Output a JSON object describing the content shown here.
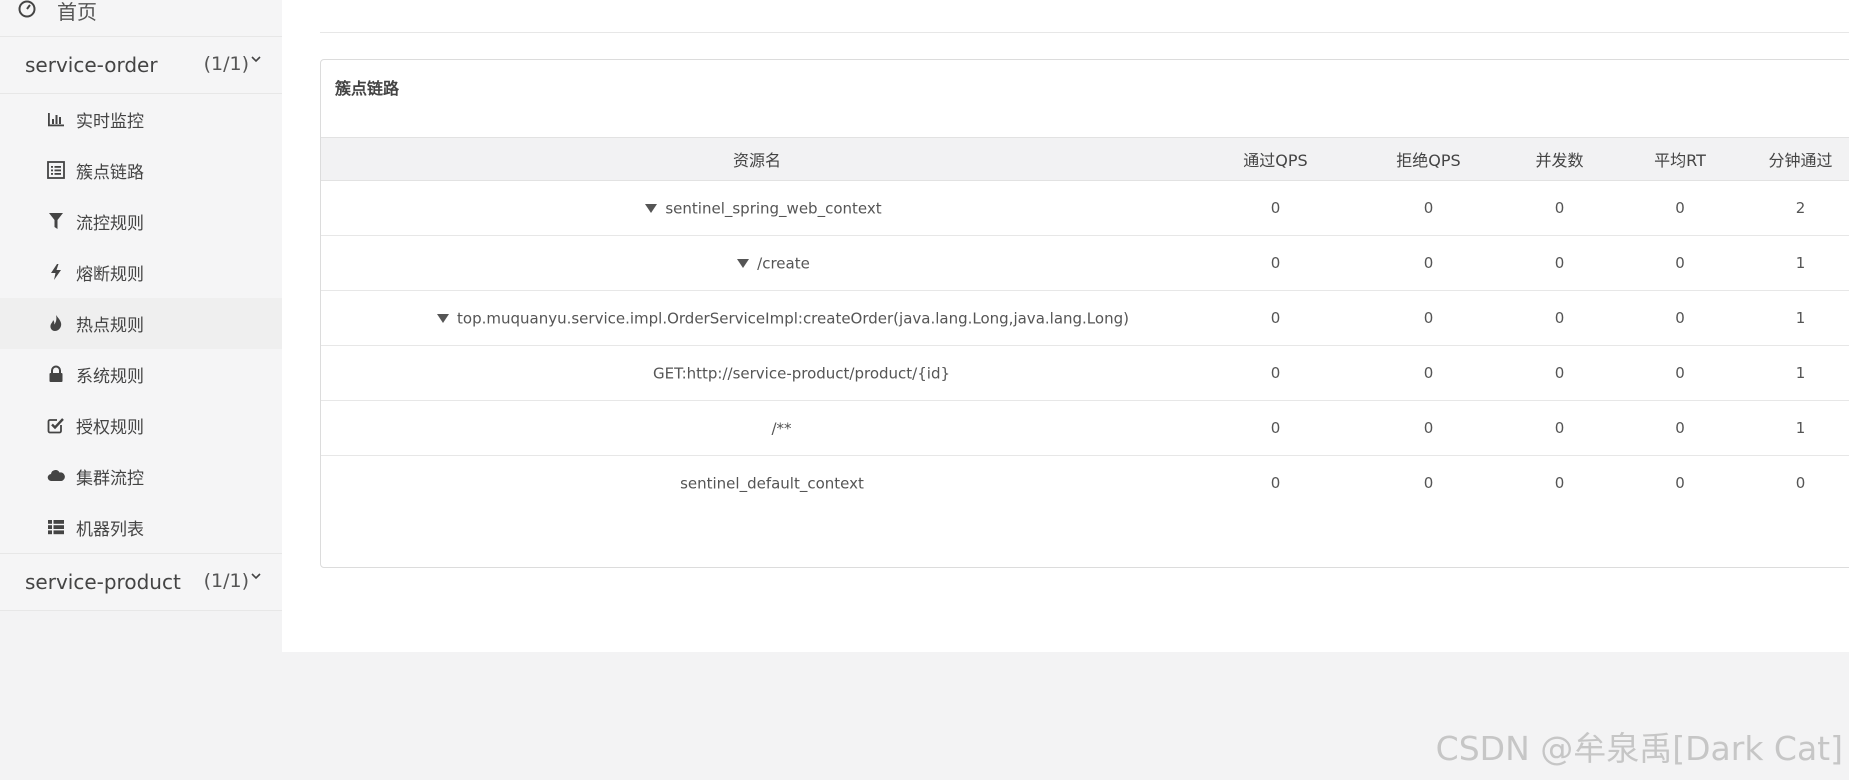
{
  "sidebar": {
    "home": {
      "label": "首页",
      "icon": "dashboard-icon"
    },
    "apps": [
      {
        "name": "service-order",
        "count": "(1/1)",
        "expanded": true,
        "items": [
          {
            "label": "实时监控",
            "icon": "bar-chart-icon"
          },
          {
            "label": "簇点链路",
            "icon": "list-alt-icon"
          },
          {
            "label": "流控规则",
            "icon": "filter-icon"
          },
          {
            "label": "熔断规则",
            "icon": "flash-icon"
          },
          {
            "label": "热点规则",
            "icon": "fire-icon"
          },
          {
            "label": "系统规则",
            "icon": "lock-icon"
          },
          {
            "label": "授权规则",
            "icon": "check-icon"
          },
          {
            "label": "集群流控",
            "icon": "cloud-icon"
          },
          {
            "label": "机器列表",
            "icon": "th-list-icon"
          }
        ]
      },
      {
        "name": "service-product",
        "count": "(1/1)",
        "expanded": false
      }
    ]
  },
  "panel": {
    "title": "簇点链路",
    "columns": [
      "资源名",
      "通过QPS",
      "拒绝QPS",
      "并发数",
      "平均RT",
      "分钟通过"
    ],
    "rows": [
      {
        "resource": "sentinel_spring_web_context",
        "level": 0,
        "expandable": true,
        "pass_qps": "0",
        "block_qps": "0",
        "concurrency": "0",
        "avg_rt": "0",
        "minute_pass": "2"
      },
      {
        "resource": "/create",
        "level": 1,
        "expandable": true,
        "pass_qps": "0",
        "block_qps": "0",
        "concurrency": "0",
        "avg_rt": "0",
        "minute_pass": "1"
      },
      {
        "resource": "top.muquanyu.service.impl.OrderServiceImpl:createOrder(java.lang.Long,java.lang.Long)",
        "level": 2,
        "expandable": true,
        "pass_qps": "0",
        "block_qps": "0",
        "concurrency": "0",
        "avg_rt": "0",
        "minute_pass": "1"
      },
      {
        "resource": "GET:http://service-product/product/{id}",
        "level": 3,
        "expandable": false,
        "pass_qps": "0",
        "block_qps": "0",
        "concurrency": "0",
        "avg_rt": "0",
        "minute_pass": "1"
      },
      {
        "resource": "/**",
        "level": 1,
        "expandable": false,
        "pass_qps": "0",
        "block_qps": "0",
        "concurrency": "0",
        "avg_rt": "0",
        "minute_pass": "1"
      },
      {
        "resource": "sentinel_default_context",
        "level": 0,
        "expandable": false,
        "pass_qps": "0",
        "block_qps": "0",
        "concurrency": "0",
        "avg_rt": "0",
        "minute_pass": "0"
      }
    ]
  },
  "watermark": "CSDN @牟泉禹[Dark Cat]"
}
